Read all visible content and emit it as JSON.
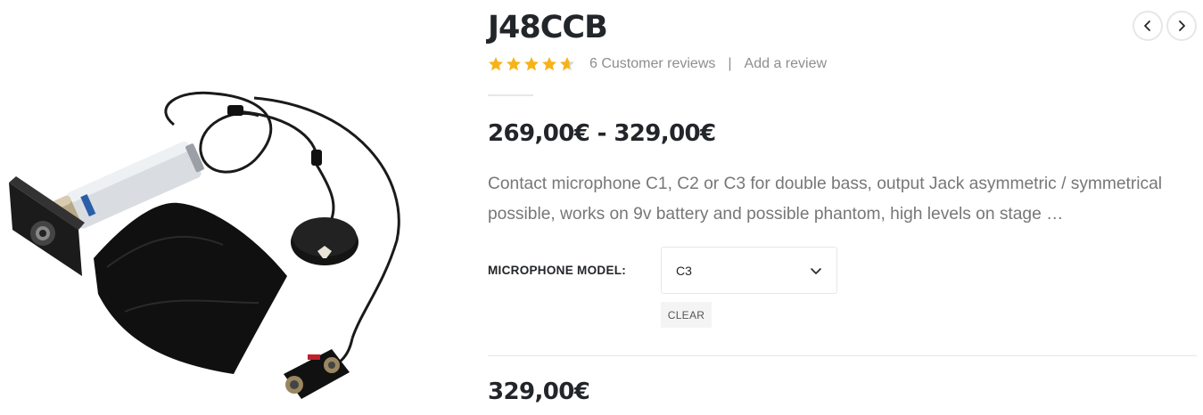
{
  "product": {
    "title": "J48CCB",
    "image_alt": "Contact microphone with preamp, cable, battery clip and pouch",
    "rating": {
      "value": 4.67,
      "max": 5,
      "star_color": "#f6b319"
    },
    "reviews_label": "6 Customer reviews",
    "separator": "|",
    "add_review_label": "Add a review",
    "price_range": "269,00€ - 329,00€",
    "description": "Contact microphone C1, C2 or C3 for double bass, output Jack asymmetric / symmetrical possible, works on 9v battery and possible phantom, high levels on stage …",
    "variation": {
      "label": "MICROPHONE MODEL:",
      "selected": "C3"
    },
    "clear_label": "CLEAR",
    "selected_price": "329,00€"
  },
  "nav": {
    "prev_icon": "chevron-left-icon",
    "next_icon": "chevron-right-icon"
  }
}
